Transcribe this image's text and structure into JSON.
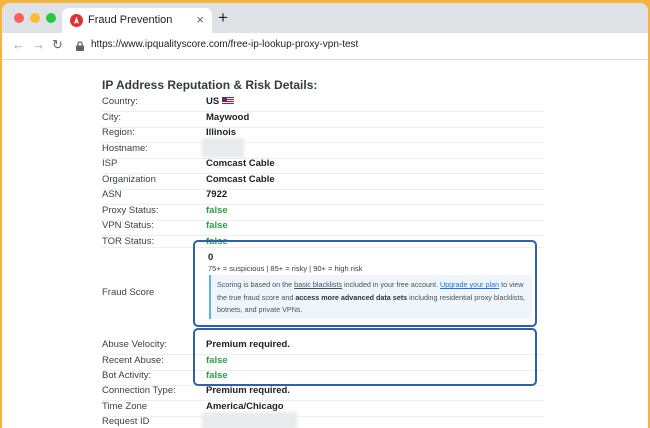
{
  "browser": {
    "tab_title": "Fraud Prevention",
    "tab_close": "×",
    "new_tab": "+",
    "url": "https://www.ipqualityscore.com/free-ip-lookup-proxy-vpn-test",
    "icons": [
      "back-arrow-icon",
      "forward-arrow-icon",
      "reload-icon",
      "lock-icon",
      "site-favicon"
    ]
  },
  "details": {
    "heading": "IP Address Reputation & Risk Details:",
    "rows": [
      {
        "label": "Country:",
        "value": "US"
      },
      {
        "label": "City:",
        "value": "Maywood"
      },
      {
        "label": "Region:",
        "value": "Illinois"
      },
      {
        "label": "Hostname:",
        "value": ""
      },
      {
        "label": "ISP",
        "value": "Comcast Cable"
      },
      {
        "label": "Organization",
        "value": "Comcast Cable"
      },
      {
        "label": "ASN",
        "value": "7922"
      },
      {
        "label": "Proxy Status:",
        "value": "false"
      },
      {
        "label": "VPN Status:",
        "value": "false"
      },
      {
        "label": "TOR Status:",
        "value": "false"
      },
      {
        "label": "Fraud Score",
        "value": ""
      },
      {
        "label": "Abuse Velocity:",
        "value": "Premium required."
      },
      {
        "label": "Recent Abuse:",
        "value": "false"
      },
      {
        "label": "Bot Activity:",
        "value": "false"
      },
      {
        "label": "Connection Type:",
        "value": "Premium required."
      },
      {
        "label": "Time Zone",
        "value": "America/Chicago"
      },
      {
        "label": "Request ID",
        "value": ""
      }
    ]
  },
  "fraud": {
    "score": "0",
    "legend": "75+ = suspicious | 85+ = risky | 90+ = high risk",
    "info_1": "Scoring is based on the ",
    "info_link_1": "basic blacklists",
    "info_2": " included in your free account. ",
    "info_link_2": "Upgrade your plan",
    "info_3": " to view the true fraud score and ",
    "info_bold": "access more advanced data sets",
    "info_4": " including residential proxy blacklists, botnets, and private VPNs."
  },
  "colors": {
    "false_green": "#2e9e44",
    "highlight_blue": "#2f5fae",
    "page_bg": "#f3b53f"
  }
}
